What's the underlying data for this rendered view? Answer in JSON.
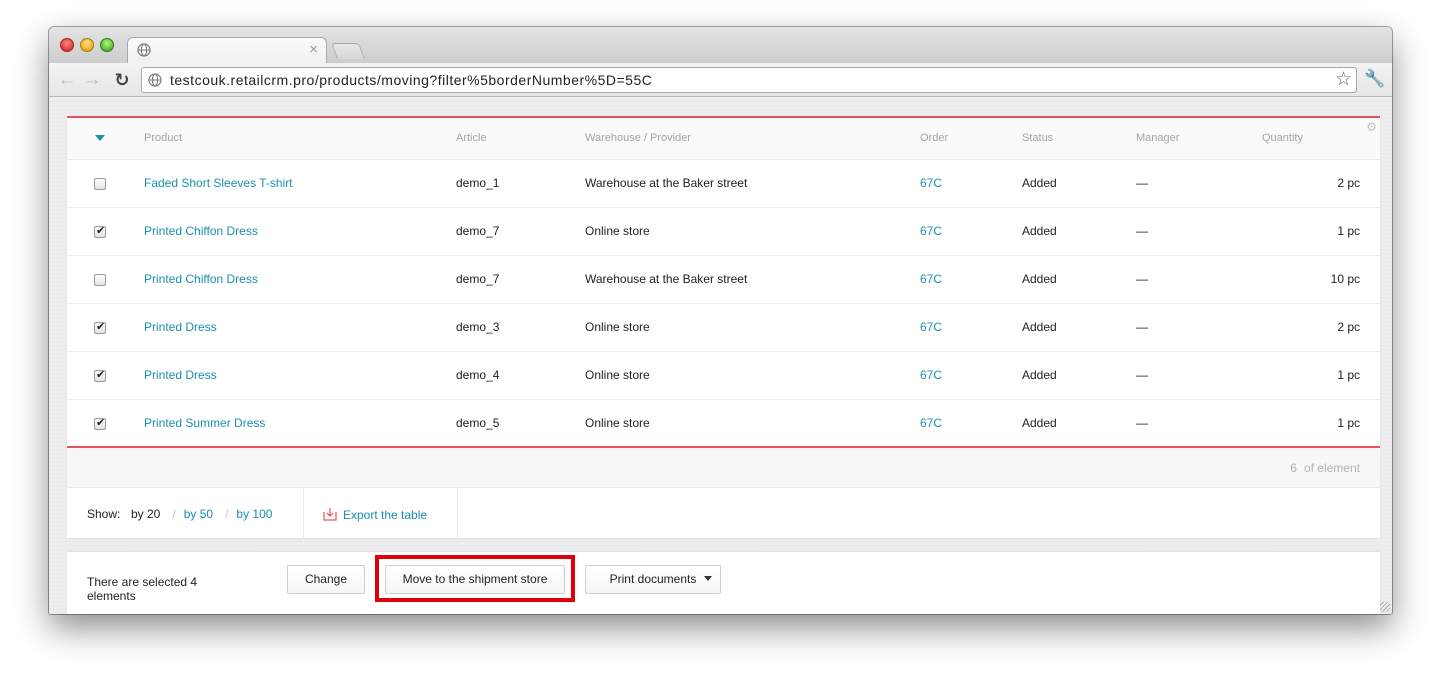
{
  "browser": {
    "url": "testcouk.retailcrm.pro/products/moving?filter%5borderNumber%5D=55C"
  },
  "table": {
    "headers": [
      "Product",
      "Article",
      "Warehouse / Provider",
      "Order",
      "Status",
      "Manager",
      "Quantity"
    ],
    "rows": [
      {
        "checked": false,
        "product": "Faded Short Sleeves T-shirt",
        "article": "demo_1",
        "warehouse": "Warehouse at the Baker street",
        "order": "67C",
        "status": "Added",
        "manager": "—",
        "quantity": "2 pc"
      },
      {
        "checked": true,
        "product": "Printed Chiffon Dress",
        "article": "demo_7",
        "warehouse": "Online store",
        "order": "67C",
        "status": "Added",
        "manager": "—",
        "quantity": "1 pc"
      },
      {
        "checked": false,
        "product": "Printed Chiffon Dress",
        "article": "demo_7",
        "warehouse": "Warehouse at the Baker street",
        "order": "67C",
        "status": "Added",
        "manager": "—",
        "quantity": "10 pc"
      },
      {
        "checked": true,
        "product": "Printed Dress",
        "article": "demo_3",
        "warehouse": "Online store",
        "order": "67C",
        "status": "Added",
        "manager": "—",
        "quantity": "2 pc"
      },
      {
        "checked": true,
        "product": "Printed Dress",
        "article": "demo_4",
        "warehouse": "Online store",
        "order": "67C",
        "status": "Added",
        "manager": "—",
        "quantity": "1 pc"
      },
      {
        "checked": true,
        "product": "Printed Summer Dress",
        "article": "demo_5",
        "warehouse": "Online store",
        "order": "67C",
        "status": "Added",
        "manager": "—",
        "quantity": "1 pc"
      }
    ]
  },
  "count": {
    "number": "6",
    "label": "of element"
  },
  "pager": {
    "show_label": "Show:",
    "options": [
      "by 20",
      "by 50",
      "by 100"
    ],
    "current": "by 20"
  },
  "export_label": "Export the table",
  "actions": {
    "selected_text": "There are selected 4 elements",
    "change_label": "Change",
    "move_label": "Move to the shipment store",
    "print_label": "Print documents"
  },
  "colors": {
    "accent_link": "#1a8fb0",
    "accent_red": "#e5545a",
    "highlight": "#e0000b"
  }
}
